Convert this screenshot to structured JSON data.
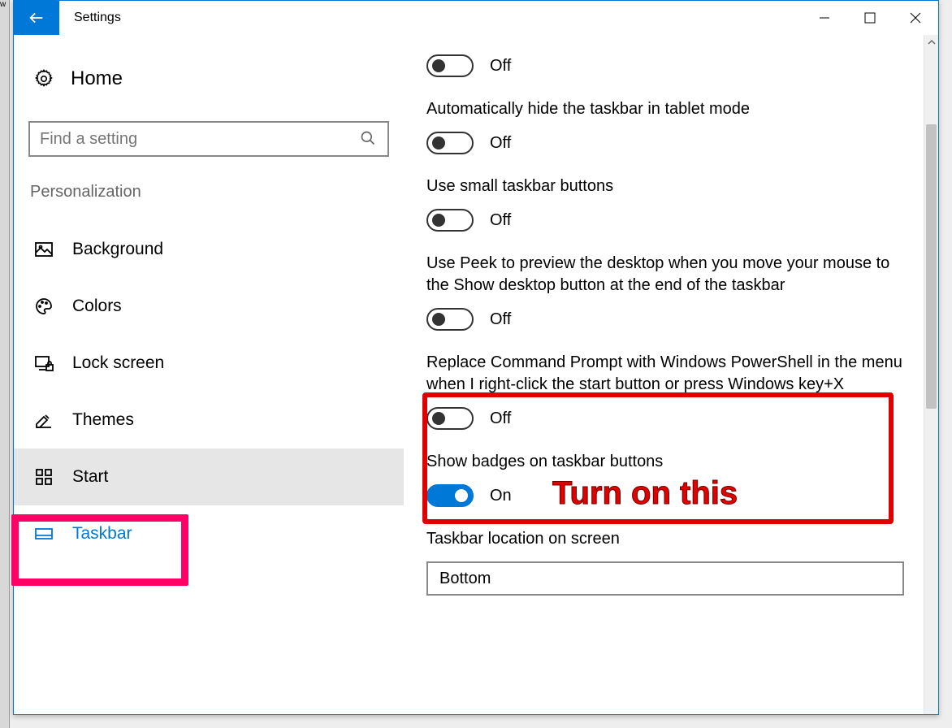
{
  "window": {
    "title": "Settings"
  },
  "sidebar": {
    "home": "Home",
    "search_placeholder": "Find a setting",
    "section": "Personalization",
    "items": [
      {
        "label": "Background"
      },
      {
        "label": "Colors"
      },
      {
        "label": "Lock screen"
      },
      {
        "label": "Themes"
      },
      {
        "label": "Start"
      },
      {
        "label": "Taskbar"
      }
    ]
  },
  "settings": {
    "s0": {
      "state": "Off"
    },
    "s1": {
      "label": "Automatically hide the taskbar in tablet mode",
      "state": "Off"
    },
    "s2": {
      "label": "Use small taskbar buttons",
      "state": "Off"
    },
    "s3": {
      "label": "Use Peek to preview the desktop when you move your mouse to the Show desktop button at the end of the taskbar",
      "state": "Off"
    },
    "s4": {
      "label": "Replace Command Prompt with Windows PowerShell in the menu when I right-click the start button or press Windows key+X",
      "state": "Off"
    },
    "s5": {
      "label": "Show badges on taskbar buttons",
      "state": "On"
    },
    "loc": {
      "label": "Taskbar location on screen",
      "value": "Bottom"
    }
  },
  "annotations": {
    "instruction": "Turn on this"
  }
}
